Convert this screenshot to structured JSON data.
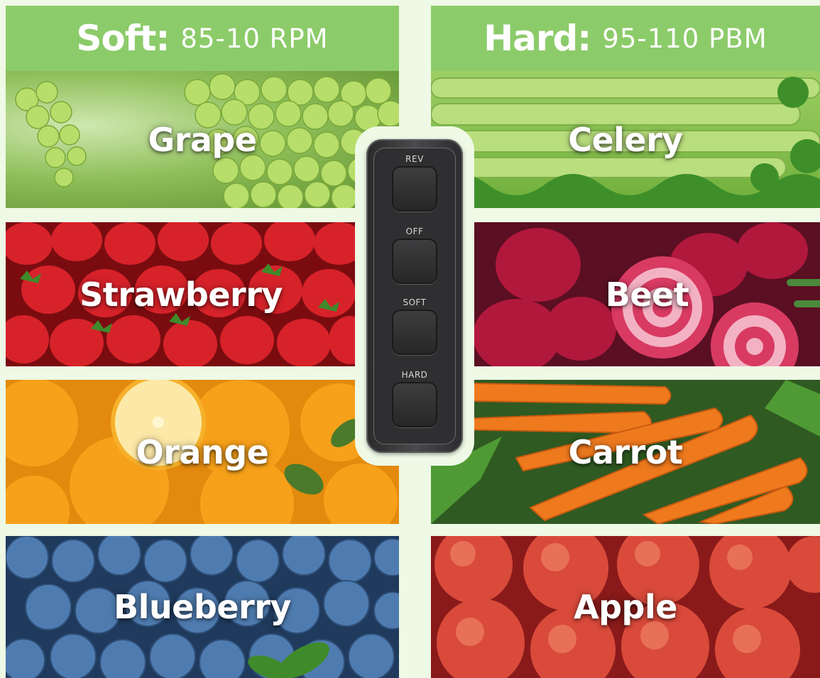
{
  "soft_header": {
    "label": "Soft:",
    "value": "85-10 RPM"
  },
  "hard_header": {
    "label": "Hard:",
    "value": "95-110 PBM"
  },
  "soft_items": [
    "Grape",
    "Strawberry",
    "Orange",
    "Blueberry"
  ],
  "hard_items": [
    "Celery",
    "Beet",
    "Carrot",
    "Apple"
  ],
  "control_panel": {
    "buttons": [
      "REV",
      "OFF",
      "SOFT",
      "HARD"
    ]
  },
  "colors": {
    "header_green": "#8ccb6a",
    "background": "#eef9e6",
    "panel": "#2f2f31"
  }
}
